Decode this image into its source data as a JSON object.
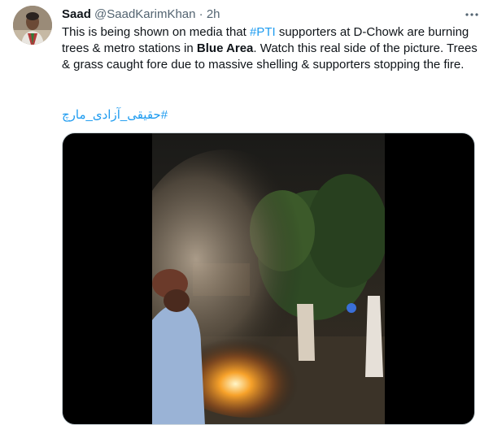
{
  "tweet": {
    "author_name": "Saad",
    "author_handle": "@SaadKarimKhan",
    "separator": "·",
    "time": "2h",
    "more_icon": "more-dots-icon",
    "text": {
      "part1": "This is being shown on media that ",
      "hashtag_pti": "#PTI",
      "part2": " supporters at D-Chowk are burning trees & metro stations in ",
      "bold": "Blue Area",
      "part3": ". Watch this real side of the picture. Trees & grass caught fore due to massive shelling & supporters stopping the fire."
    },
    "hashtag_urdu": "#حقیقی_آزادی_مارچ"
  },
  "colors": {
    "link": "#1d9bf0",
    "text": "#0f1419",
    "muted": "#536471",
    "media_background": "#000000"
  }
}
